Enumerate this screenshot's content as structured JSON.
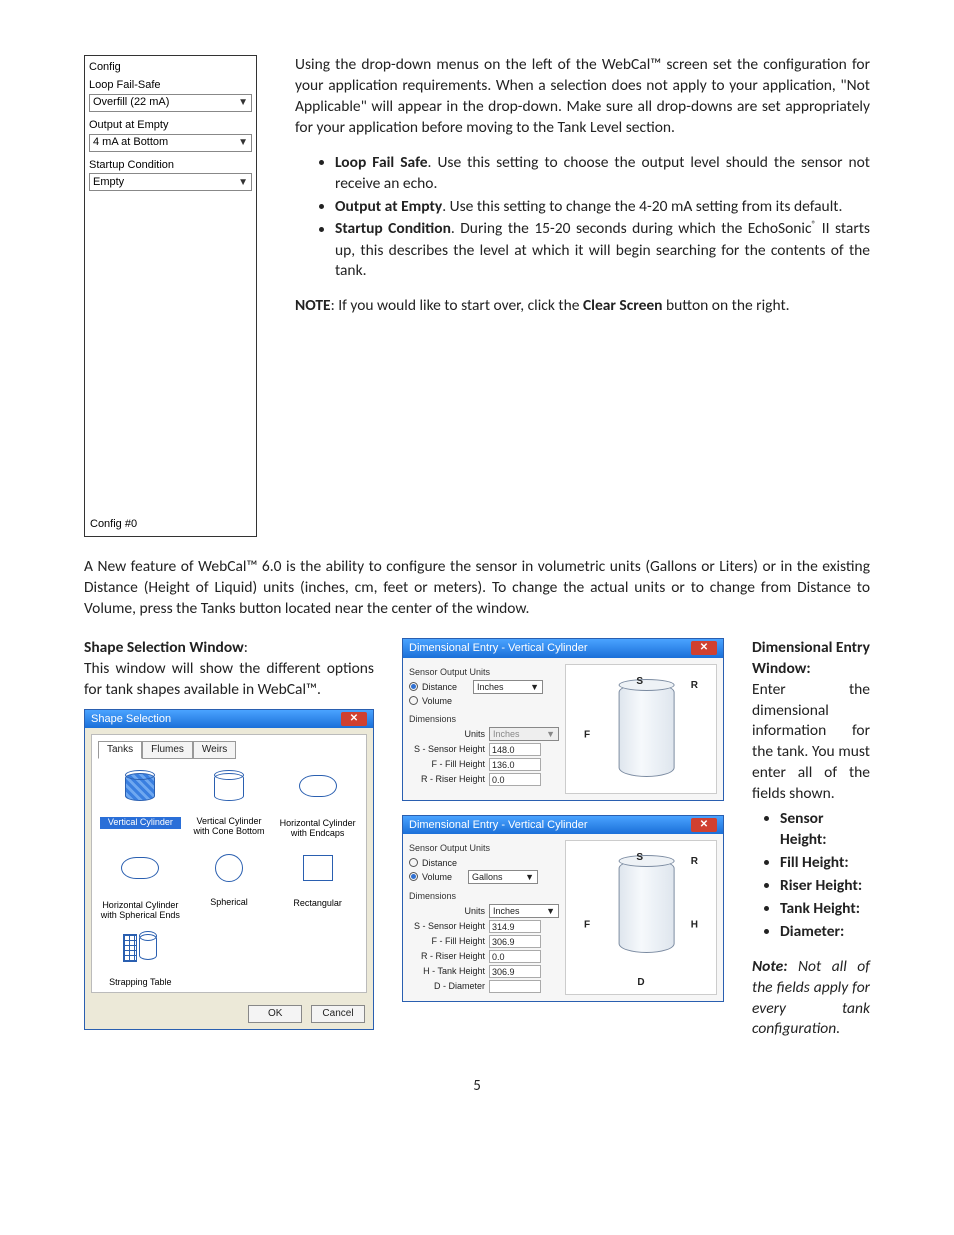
{
  "config_panel": {
    "title": "Config",
    "loop_label": "Loop Fail-Safe",
    "loop_value": "Overfill (22 mA)",
    "output_label": "Output at Empty",
    "output_value": "4 mA at Bottom",
    "startup_label": "Startup Condition",
    "startup_value": "Empty",
    "footer": "Config #0"
  },
  "intro": "Using the drop-down menus on the left of the WebCal™ screen set the configuration for your application requirements. When a selection does not apply to your application, \"Not Applicable\" will appear in the drop-down. Make sure all drop-downs are set appropriately for your application before moving to the Tank Level section.",
  "bullets": {
    "b1_title": "Loop Fail Safe",
    "b1_text": ". Use this setting to choose the output level should the sensor not receive an echo.",
    "b2_title": "Output at Empty",
    "b2_text": ". Use this setting to change the 4-20 mA setting from its default.",
    "b3_title": "Startup Condition",
    "b3_text_a": ". During the 15-20 seconds during which the EchoSonic",
    "b3_text_b": " II starts up, this describes the level at which it will begin searching for the contents of the tank."
  },
  "note": {
    "label": "NOTE",
    "mid": ": If you would like to start over, click the ",
    "button": "Clear Screen",
    "end": " button on the right."
  },
  "para2": "A New feature of WebCal™ 6.0 is the ability to configure the sensor in volumetric units (Gallons or Liters) or in the existing Distance (Height of Liquid) units (inches, cm, feet or meters).  To change the actual units or to change from Distance to Volume, press the Tanks button located near the center of the window.",
  "shape": {
    "heading": "Shape Selection Window",
    "desc": "This window will show the different options for tank shapes available in WebCal™.",
    "win_title": "Shape Selection",
    "tabs": {
      "t1": "Tanks",
      "t2": "Flumes",
      "t3": "Weirs"
    },
    "s1": "Vertical Cylinder",
    "s2": "Vertical Cylinder with Cone Bottom",
    "s3": "Horizontal Cylinder with Endcaps",
    "s4": "Horizontal Cylinder with Spherical Ends",
    "s5": "Spherical",
    "s6": "Rectangular",
    "s7": "Strapping Table",
    "ok": "OK",
    "cancel": "Cancel"
  },
  "dim": {
    "heading": "Dimensional Entry Window:",
    "desc": "Enter the dimensional information for the tank.  You must enter all of the fields shown.",
    "win_title": "Dimensional Entry - Vertical Cylinder",
    "sou": "Sensor Output Units",
    "distance": "Distance",
    "volume": "Volume",
    "inches": "Inches",
    "gallons": "Gallons",
    "dims": "Dimensions",
    "units": "Units",
    "s": "S - Sensor Height",
    "f": "F - Fill Height",
    "r": "R - Riser Height",
    "h": "H - Tank Height",
    "d": "D - Diameter",
    "v1": {
      "s": "148.0",
      "f": "136.0",
      "r": "0.0"
    },
    "v2": {
      "s": "314.9",
      "f": "306.9",
      "r": "0.0",
      "h": "306.9",
      "d": ""
    },
    "list": {
      "l1": "Sensor Height:",
      "l2": "Fill Height:",
      "l3": "Riser Height:",
      "l4": "Tank Height:",
      "l5": "Diameter:"
    },
    "note_b": "Note:",
    "note_txt": " Not all of the fields apply for every tank configuration."
  },
  "labels": {
    "S": "S",
    "R": "R",
    "F": "F",
    "H": "H",
    "D": "D"
  },
  "page": "5"
}
